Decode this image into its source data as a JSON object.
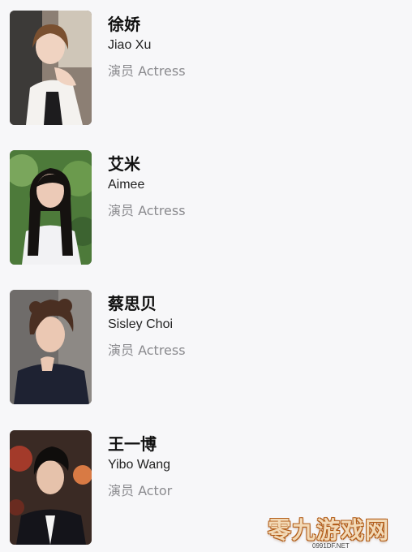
{
  "cast": [
    {
      "name_zh": "徐娇",
      "name_en": "Jiao Xu",
      "role": "演员 Actress",
      "photo": "portrait-jiao-xu"
    },
    {
      "name_zh": "艾米",
      "name_en": "Aimee",
      "role": "演员 Actress",
      "photo": "portrait-aimee"
    },
    {
      "name_zh": "蔡思贝",
      "name_en": "Sisley Choi",
      "role": "演员 Actress",
      "photo": "portrait-sisley-choi"
    },
    {
      "name_zh": "王一博",
      "name_en": "Yibo Wang",
      "role": "演员 Actor",
      "photo": "portrait-yibo-wang"
    }
  ],
  "watermark": {
    "main": "零九游戏网",
    "sub": "0991DF.NET"
  }
}
